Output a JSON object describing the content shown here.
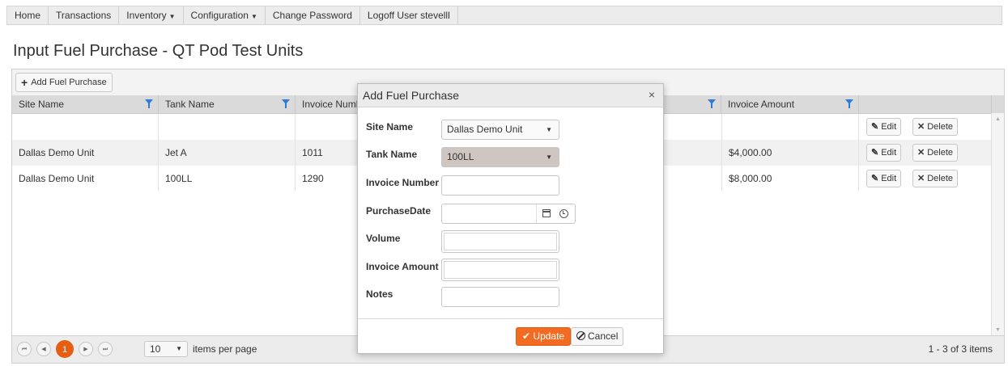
{
  "nav": {
    "home": "Home",
    "transactions": "Transactions",
    "inventory": "Inventory",
    "configuration": "Configuration",
    "change_password": "Change Password",
    "logoff": "Logoff User stevelll",
    "caret": "▼"
  },
  "page": {
    "title": "Input Fuel Purchase - QT Pod Test Units"
  },
  "toolbar": {
    "add_label": "Add Fuel Purchase",
    "plus": "+"
  },
  "columns": [
    "Site Name",
    "Tank Name",
    "Invoice Numb",
    "Invoice Amount"
  ],
  "rows": [
    {
      "site": "Dallas Demo Unit",
      "tank": "Jet A",
      "invoice": "1011",
      "amount": "$4,000.00"
    },
    {
      "site": "Dallas Demo Unit",
      "tank": "100LL",
      "invoice": "1290",
      "amount": "$8,000.00"
    }
  ],
  "row_actions": {
    "edit": "Edit",
    "delete": "Delete",
    "edit_icon": "✎",
    "delete_icon": "✕"
  },
  "pager": {
    "first": "⏮",
    "prev": "◀",
    "current": "1",
    "next": "▶",
    "last": "⏭",
    "page_size": "10",
    "per_page_label": "items per page",
    "info": "1 - 3 of 3 items"
  },
  "modal": {
    "title": "Add Fuel Purchase",
    "close": "×",
    "labels": {
      "site": "Site Name",
      "tank": "Tank Name",
      "invoice_number": "Invoice Number",
      "purchase_date": "PurchaseDate",
      "volume": "Volume",
      "invoice_amount": "Invoice Amount",
      "notes": "Notes"
    },
    "values": {
      "site": "Dallas Demo Unit",
      "tank": "100LL"
    },
    "update_label": "Update",
    "update_icon": "✔",
    "cancel_label": "Cancel"
  },
  "colors": {
    "accent": "#f26b21",
    "filter": "#2b7bd8",
    "header_bg": "#dadada"
  },
  "icons": [
    "filter-icon",
    "plus-icon",
    "edit-icon",
    "delete-icon",
    "calendar-icon",
    "clock-icon",
    "close-icon",
    "check-icon",
    "ban-icon"
  ]
}
